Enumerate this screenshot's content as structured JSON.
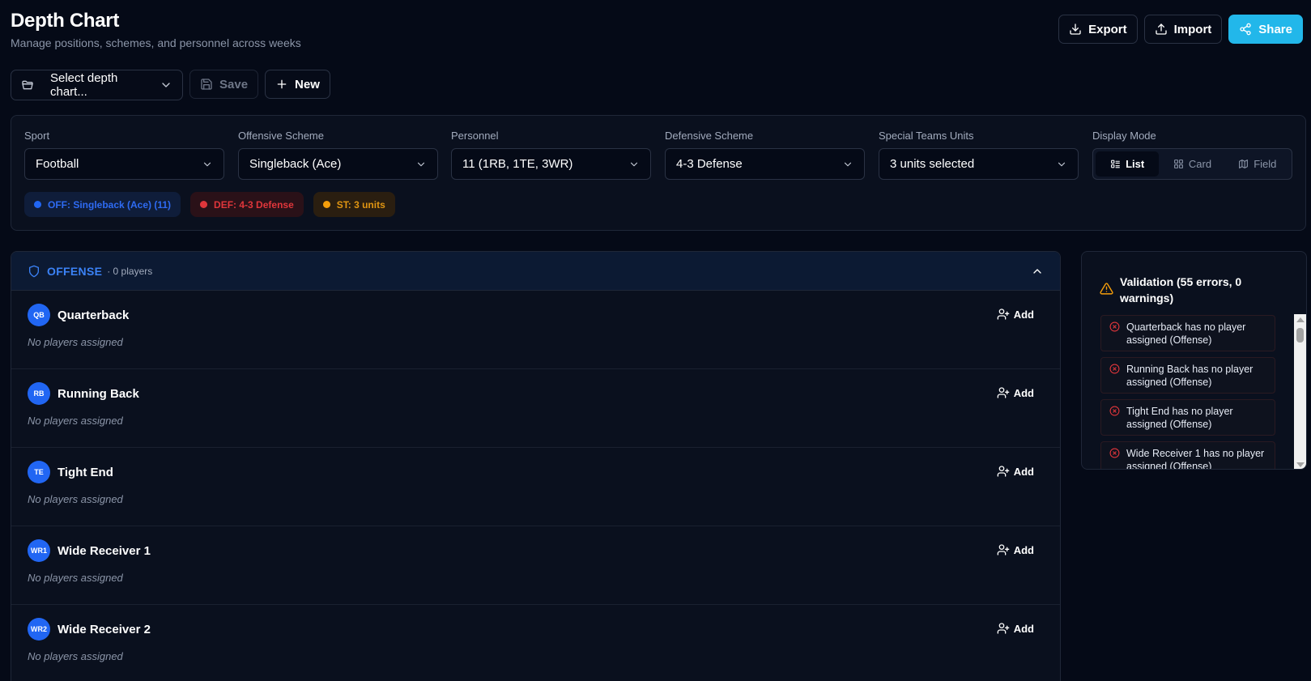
{
  "header": {
    "title": "Depth Chart",
    "subtitle": "Manage positions, schemes, and personnel across weeks"
  },
  "actions": {
    "export": "Export",
    "import": "Import",
    "share": "Share"
  },
  "toolbar": {
    "select_chart": "Select depth chart...",
    "save": "Save",
    "new": "New"
  },
  "filters": {
    "sport": {
      "label": "Sport",
      "value": "Football"
    },
    "offensive_scheme": {
      "label": "Offensive Scheme",
      "value": "Singleback (Ace)"
    },
    "personnel": {
      "label": "Personnel",
      "value": "11 (1RB, 1TE, 3WR)"
    },
    "defensive_scheme": {
      "label": "Defensive Scheme",
      "value": "4-3 Defense"
    },
    "special_teams": {
      "label": "Special Teams Units",
      "value": "3 units selected"
    },
    "display_mode": {
      "label": "Display Mode",
      "options": [
        "List",
        "Card",
        "Field"
      ],
      "selected": "List"
    }
  },
  "chips": {
    "offense": "OFF: Singleback (Ace) (11)",
    "defense": "DEF: 4-3 Defense",
    "special": "ST: 3 units"
  },
  "offense": {
    "title": "OFFENSE",
    "count": "· 0 players",
    "add_label": "Add",
    "empty_text": "No players assigned",
    "positions": [
      {
        "abbr": "QB",
        "name": "Quarterback"
      },
      {
        "abbr": "RB",
        "name": "Running Back"
      },
      {
        "abbr": "TE",
        "name": "Tight End"
      },
      {
        "abbr": "WR1",
        "name": "Wide Receiver 1"
      },
      {
        "abbr": "WR2",
        "name": "Wide Receiver 2"
      }
    ]
  },
  "validation": {
    "title": "Validation (55 errors, 0 warnings)",
    "items": [
      "Quarterback has no player assigned (Offense)",
      "Running Back has no player assigned (Offense)",
      "Tight End has no player assigned (Offense)",
      "Wide Receiver 1 has no player assigned (Offense)"
    ]
  },
  "colors": {
    "background": "#050a17",
    "accent": "#22b7ea",
    "offense": "#2166f3",
    "defense": "#e0363b",
    "special": "#f59e0b"
  }
}
